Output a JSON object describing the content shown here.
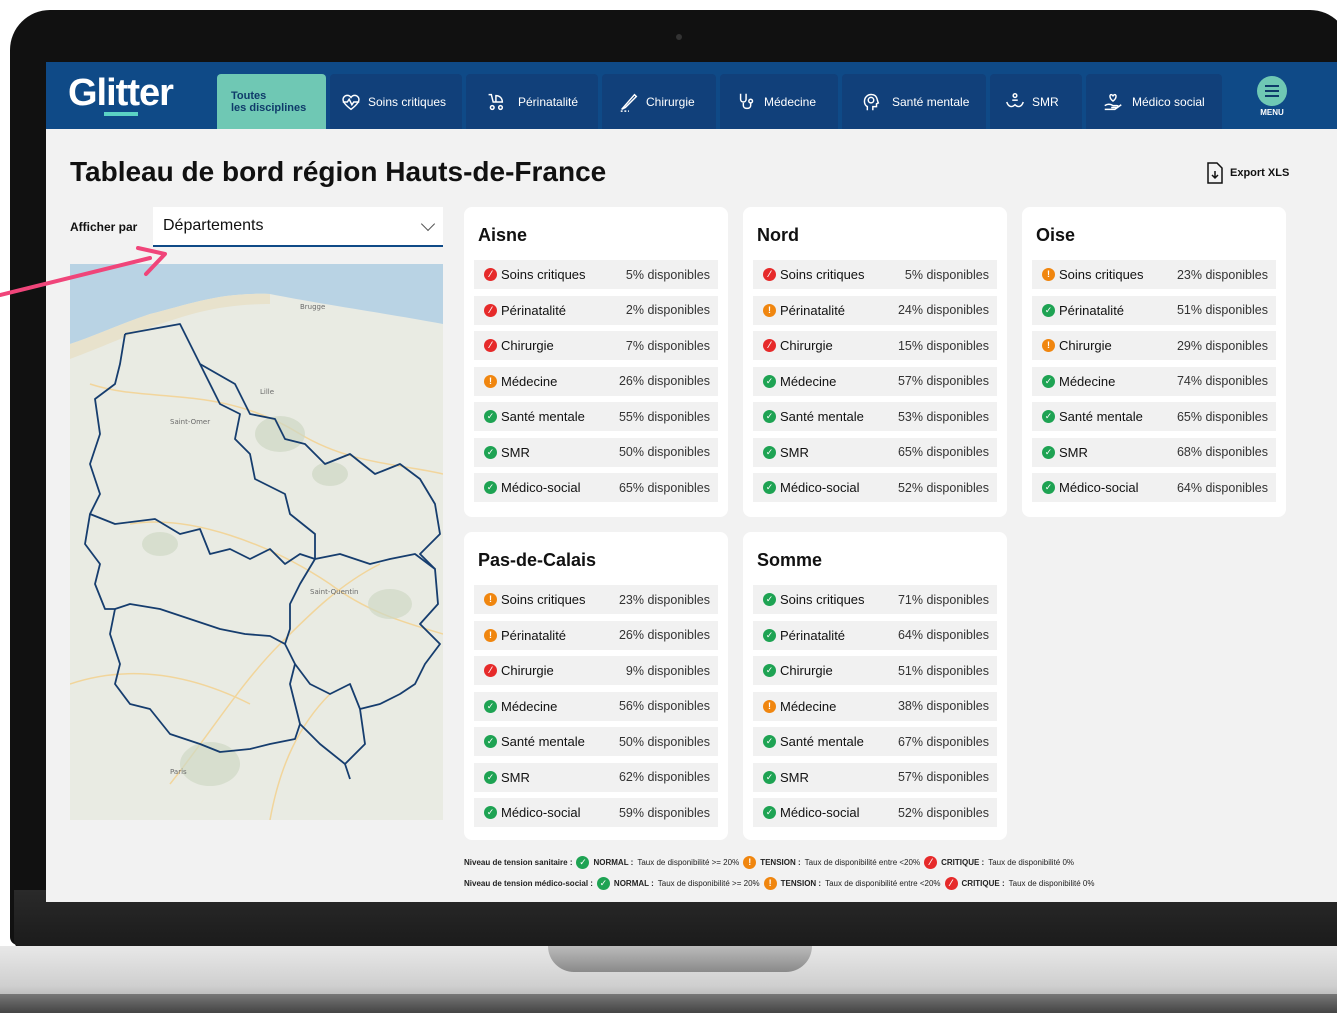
{
  "app": {
    "logo": "Glitter"
  },
  "nav": {
    "tabs": [
      {
        "label_line1": "Toutes",
        "label_line2": "les disciplines",
        "icon": "none",
        "active": true
      },
      {
        "label": "Soins critiques",
        "icon": "heart-pulse-icon"
      },
      {
        "label": "Périnatalité",
        "icon": "stroller-icon"
      },
      {
        "label": "Chirurgie",
        "icon": "scalpel-icon"
      },
      {
        "label": "Médecine",
        "icon": "stethoscope-icon"
      },
      {
        "label": "Santé mentale",
        "icon": "head-brain-icon"
      },
      {
        "label": "SMR",
        "icon": "people-icon"
      },
      {
        "label": "Médico social",
        "icon": "hand-heart-icon"
      }
    ],
    "menu_label": "MENU"
  },
  "page": {
    "title": "Tableau de bord région Hauts-de-France",
    "export_label": "Export XLS",
    "afficher_label": "Afficher par",
    "select_value": "Départements"
  },
  "departments": [
    {
      "name": "Aisne",
      "rows": [
        {
          "label": "Soins critiques",
          "status": "critique",
          "value": "5% disponibles"
        },
        {
          "label": "Périnatalité",
          "status": "critique",
          "value": "2% disponibles"
        },
        {
          "label": "Chirurgie",
          "status": "critique",
          "value": "7% disponibles"
        },
        {
          "label": "Médecine",
          "status": "tension",
          "value": "26% disponibles"
        },
        {
          "label": "Santé mentale",
          "status": "normal",
          "value": "55% disponibles"
        },
        {
          "label": "SMR",
          "status": "normal",
          "value": "50% disponibles"
        },
        {
          "label": "Médico-social",
          "status": "normal",
          "value": "65% disponibles"
        }
      ]
    },
    {
      "name": "Nord",
      "rows": [
        {
          "label": "Soins critiques",
          "status": "critique",
          "value": "5% disponibles"
        },
        {
          "label": "Périnatalité",
          "status": "tension",
          "value": "24% disponibles"
        },
        {
          "label": "Chirurgie",
          "status": "critique",
          "value": "15% disponibles"
        },
        {
          "label": "Médecine",
          "status": "normal",
          "value": "57% disponibles"
        },
        {
          "label": "Santé mentale",
          "status": "normal",
          "value": "53% disponibles"
        },
        {
          "label": "SMR",
          "status": "normal",
          "value": "65% disponibles"
        },
        {
          "label": "Médico-social",
          "status": "normal",
          "value": "52% disponibles"
        }
      ]
    },
    {
      "name": "Oise",
      "rows": [
        {
          "label": "Soins critiques",
          "status": "tension",
          "value": "23% disponibles"
        },
        {
          "label": "Périnatalité",
          "status": "normal",
          "value": "51% disponibles"
        },
        {
          "label": "Chirurgie",
          "status": "tension",
          "value": "29% disponibles"
        },
        {
          "label": "Médecine",
          "status": "normal",
          "value": "74% disponibles"
        },
        {
          "label": "Santé mentale",
          "status": "normal",
          "value": "65% disponibles"
        },
        {
          "label": "SMR",
          "status": "normal",
          "value": "68% disponibles"
        },
        {
          "label": "Médico-social",
          "status": "normal",
          "value": "64% disponibles"
        }
      ]
    },
    {
      "name": "Pas-de-Calais",
      "rows": [
        {
          "label": "Soins critiques",
          "status": "tension",
          "value": "23% disponibles"
        },
        {
          "label": "Périnatalité",
          "status": "tension",
          "value": "26% disponibles"
        },
        {
          "label": "Chirurgie",
          "status": "critique",
          "value": "9% disponibles"
        },
        {
          "label": "Médecine",
          "status": "normal",
          "value": "56% disponibles"
        },
        {
          "label": "Santé mentale",
          "status": "normal",
          "value": "50% disponibles"
        },
        {
          "label": "SMR",
          "status": "normal",
          "value": "62% disponibles"
        },
        {
          "label": "Médico-social",
          "status": "normal",
          "value": "59% disponibles"
        }
      ]
    },
    {
      "name": "Somme",
      "rows": [
        {
          "label": "Soins critiques",
          "status": "normal",
          "value": "71% disponibles"
        },
        {
          "label": "Périnatalité",
          "status": "normal",
          "value": "64% disponibles"
        },
        {
          "label": "Chirurgie",
          "status": "normal",
          "value": "51% disponibles"
        },
        {
          "label": "Médecine",
          "status": "tension",
          "value": "38% disponibles"
        },
        {
          "label": "Santé mentale",
          "status": "normal",
          "value": "67% disponibles"
        },
        {
          "label": "SMR",
          "status": "normal",
          "value": "57% disponibles"
        },
        {
          "label": "Médico-social",
          "status": "normal",
          "value": "52% disponibles"
        }
      ]
    }
  ],
  "legend": [
    {
      "title": "Niveau de tension sanitaire :",
      "normal": "NORMAL :",
      "normal_desc": "Taux de disponibilité >= 20%",
      "tension": "TENSION :",
      "tension_desc": "Taux de disponibilité entre <20%",
      "critique": "CRITIQUE :",
      "critique_desc": "Taux de disponibilité 0%"
    },
    {
      "title": "Niveau de tension médico-social :",
      "normal": "NORMAL :",
      "normal_desc": "Taux de disponibilité >= 20%",
      "tension": "TENSION :",
      "tension_desc": "Taux de disponibilité entre <20%",
      "critique": "CRITIQUE :",
      "critique_desc": "Taux de disponibilité 0%"
    }
  ],
  "colors": {
    "brand": "#0f4a87",
    "accent": "#6fc8b4",
    "normal": "#1ea353",
    "tension": "#f0860f",
    "critique": "#e62a2a",
    "annotation_arrow": "#f0457a"
  }
}
